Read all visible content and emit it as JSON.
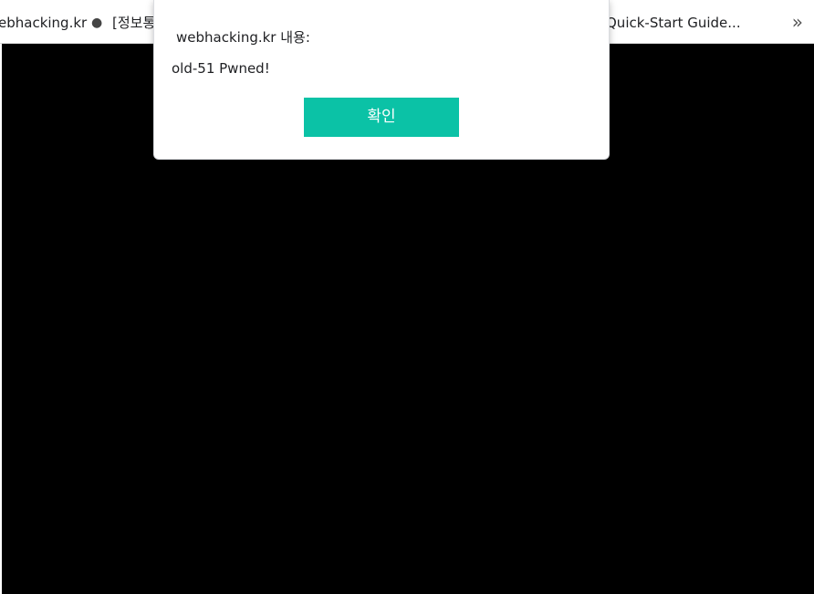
{
  "bookmarks": [
    {
      "label": "ebhacking.kr"
    },
    {
      "label": "[정보통"
    },
    {
      "label": "Quick-Start Guide..."
    }
  ],
  "bookmark_separator": "●",
  "bookmarks_overflow_glyph": "»",
  "dialog": {
    "title": "webhacking.kr 내용:",
    "message": "old-51 Pwned!",
    "ok_label": "확인",
    "ok_color": "#0bc2a6"
  },
  "page": {
    "background": "#000000"
  }
}
